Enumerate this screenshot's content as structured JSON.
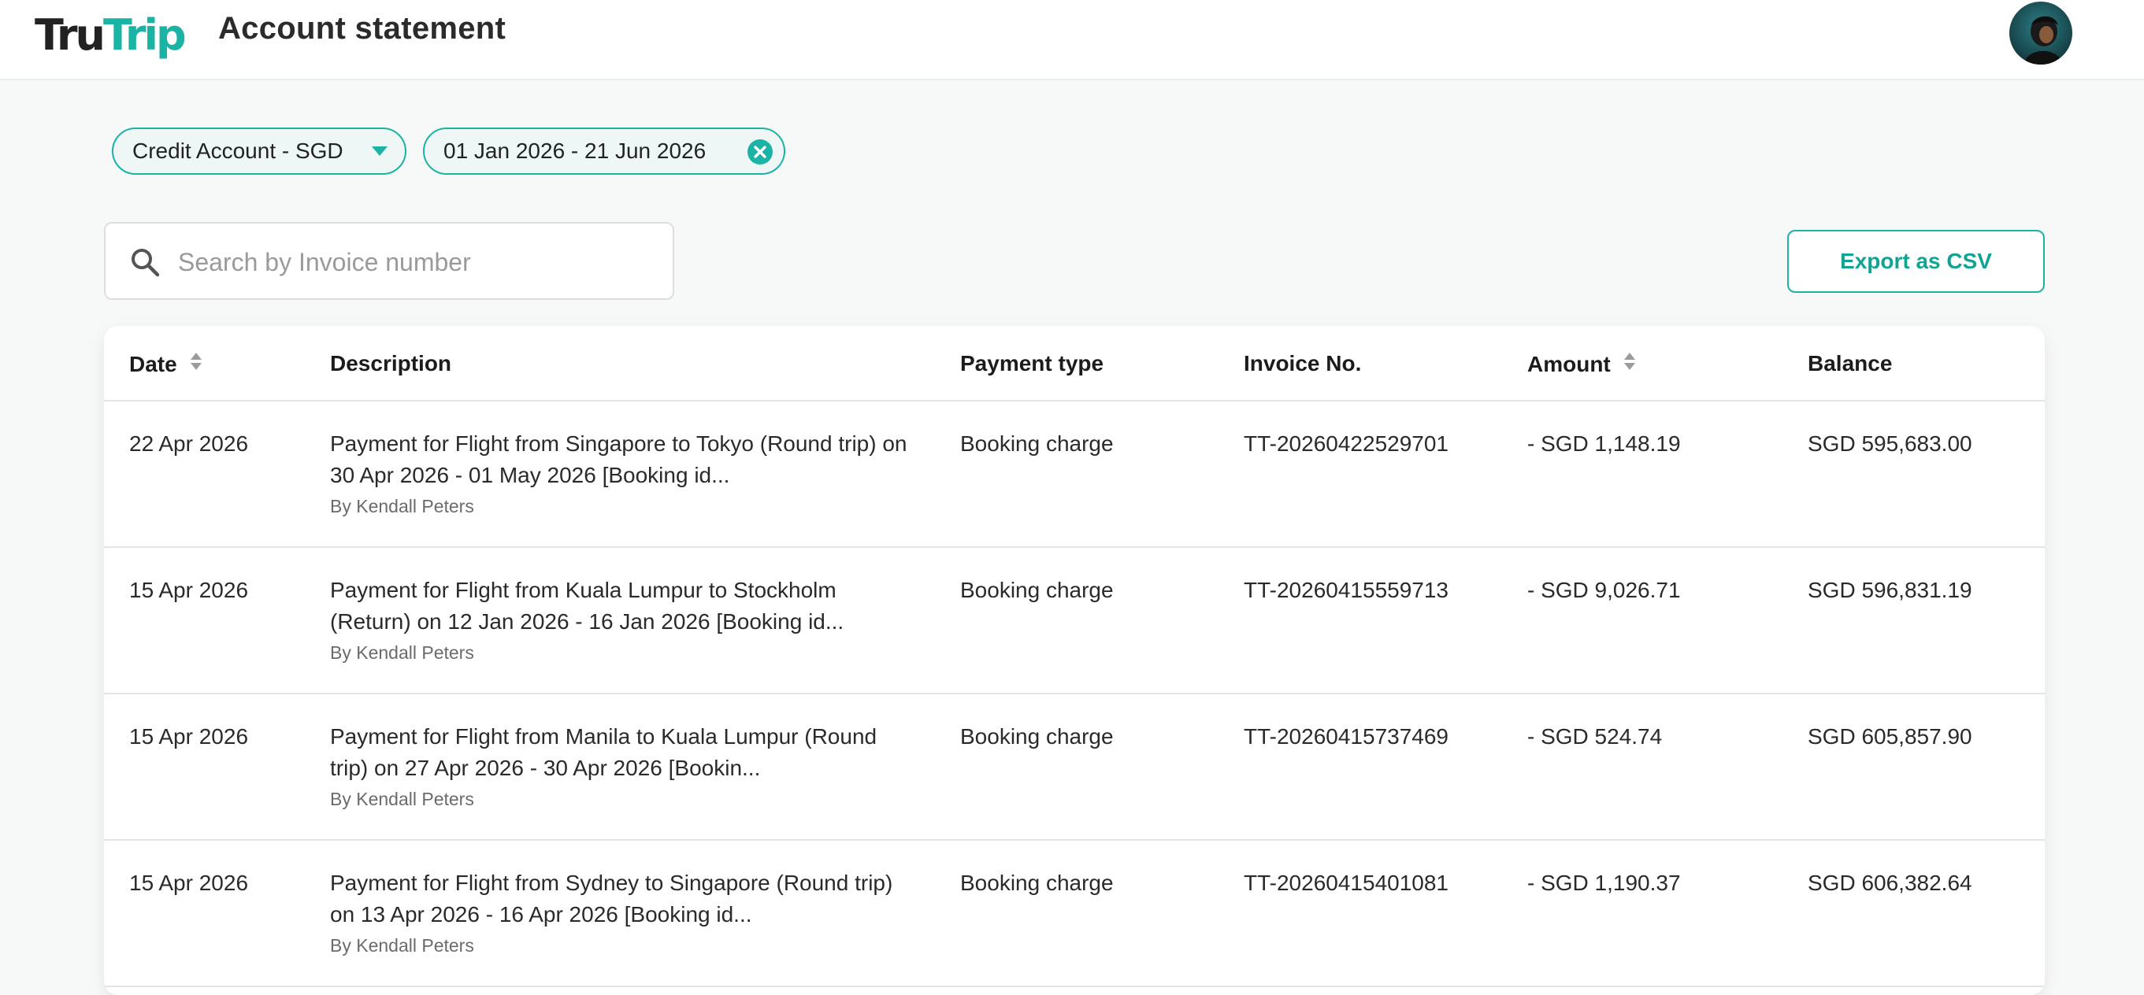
{
  "header": {
    "logo_left": "Tru",
    "logo_right": "Trip",
    "title": "Account statement"
  },
  "filters": {
    "account": "Credit Account - SGD",
    "date_range": "01 Jan 2026 - 21 Jun 2026"
  },
  "search": {
    "placeholder": "Search by Invoice number",
    "value": ""
  },
  "export_label": "Export as CSV",
  "table": {
    "columns": {
      "date": "Date",
      "description": "Description",
      "payment_type": "Payment type",
      "invoice": "Invoice No.",
      "amount": "Amount",
      "balance": "Balance"
    },
    "rows": [
      {
        "date": "22 Apr 2026",
        "description": "Payment for Flight from Singapore to Tokyo (Round trip) on 30 Apr 2026 - 01 May 2026 [Booking id...",
        "by": "By Kendall Peters",
        "payment_type": "Booking charge",
        "invoice": "TT-20260422529701",
        "amount": "- SGD 1,148.19",
        "balance": "SGD 595,683.00"
      },
      {
        "date": "15 Apr 2026",
        "description": "Payment for Flight from Kuala Lumpur to Stockholm (Return) on 12 Jan 2026 - 16 Jan 2026 [Booking id...",
        "by": "By Kendall Peters",
        "payment_type": "Booking charge",
        "invoice": "TT-20260415559713",
        "amount": "- SGD 9,026.71",
        "balance": "SGD 596,831.19"
      },
      {
        "date": "15 Apr 2026",
        "description": "Payment for Flight from Manila to Kuala Lumpur (Round trip) on 27 Apr 2026 - 30 Apr 2026 [Bookin...",
        "by": "By Kendall Peters",
        "payment_type": "Booking charge",
        "invoice": "TT-20260415737469",
        "amount": "- SGD 524.74",
        "balance": "SGD 605,857.90"
      },
      {
        "date": "15 Apr 2026",
        "description": "Payment for Flight from Sydney to Singapore (Round trip) on 13 Apr 2026 - 16 Apr 2026 [Booking id...",
        "by": "By Kendall Peters",
        "payment_type": "Booking charge",
        "invoice": "TT-20260415401081",
        "amount": "- SGD 1,190.37",
        "balance": "SGD 606,382.64"
      }
    ]
  },
  "colors": {
    "brand": "#1bb3a3",
    "logo_dark": "#222222",
    "background": "#f7f8f8"
  },
  "icons": {
    "search": "search-icon",
    "dropdown": "chevron-down-icon",
    "clear": "close-icon",
    "sort": "sort-icon",
    "avatar": "avatar"
  }
}
